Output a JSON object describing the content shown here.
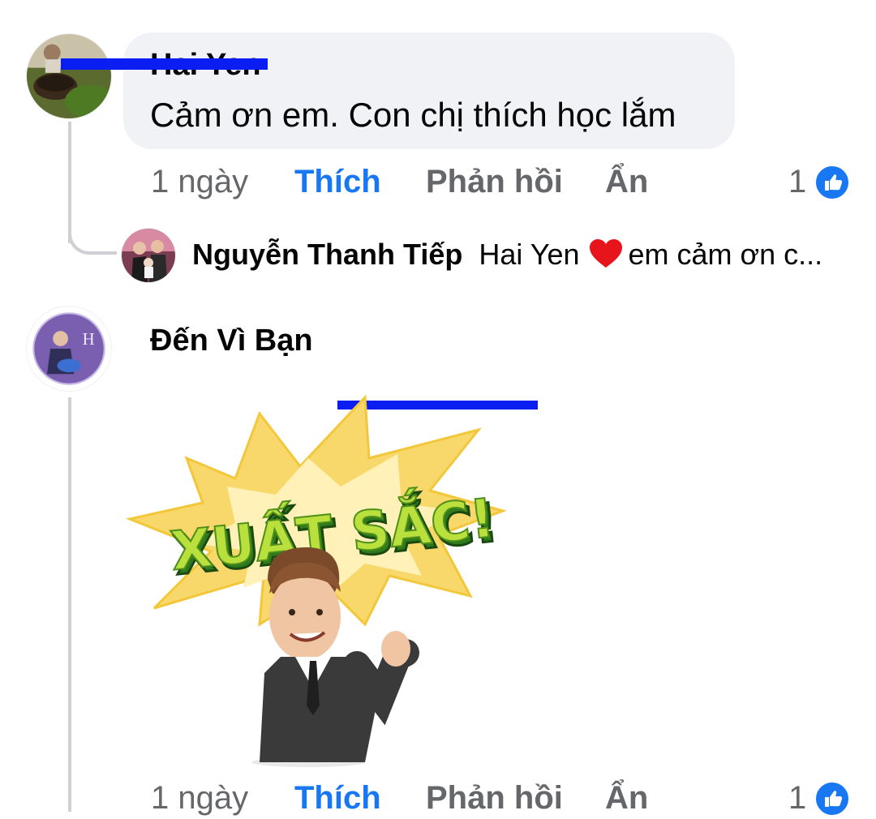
{
  "comment1": {
    "author": "Hai Yen",
    "text": "Cảm ơn em. Con chị thích học lắm",
    "actions": {
      "time": "1 ngày",
      "like": "Thích",
      "reply": "Phản hồi",
      "hide": "Ẩn"
    },
    "reaction_count": "1",
    "reaction_icon": "like-icon"
  },
  "reply": {
    "author": "Nguyễn Thanh Tiếp",
    "mention": "Hai Yen",
    "emoji": "heart-emoji",
    "text": "em cảm ơn c..."
  },
  "comment2": {
    "author": "Đến Vì Bạn",
    "sticker_text": "XUẤT SẮC!",
    "actions": {
      "time": "1 ngày",
      "like": "Thích",
      "reply": "Phản hồi",
      "hide": "Ẩn"
    },
    "reaction_count": "1",
    "reaction_icon": "like-icon"
  },
  "colors": {
    "like_blue": "#1877f2",
    "muted_text": "#65676b",
    "bubble_bg": "#f0f2f5",
    "redaction": "#0a1ef2"
  }
}
